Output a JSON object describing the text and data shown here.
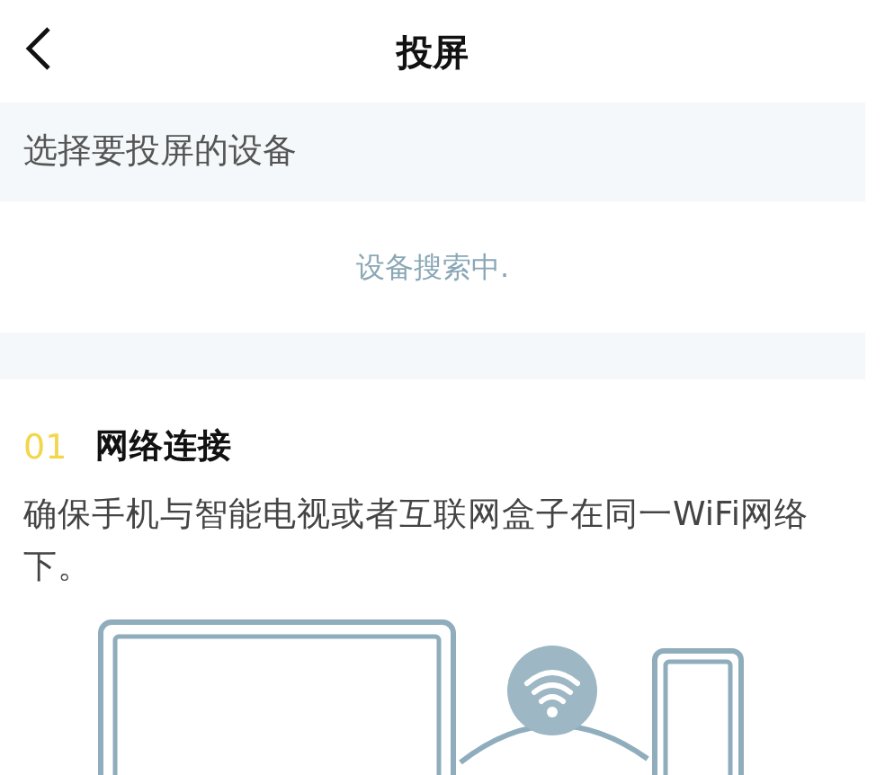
{
  "header": {
    "title": "投屏"
  },
  "device_section": {
    "heading": "选择要投屏的设备",
    "status": "设备搜索中."
  },
  "steps": [
    {
      "number": "01",
      "title": "网络连接",
      "description": "确保手机与智能电视或者互联网盒子在同一WiFi网络下。"
    }
  ]
}
